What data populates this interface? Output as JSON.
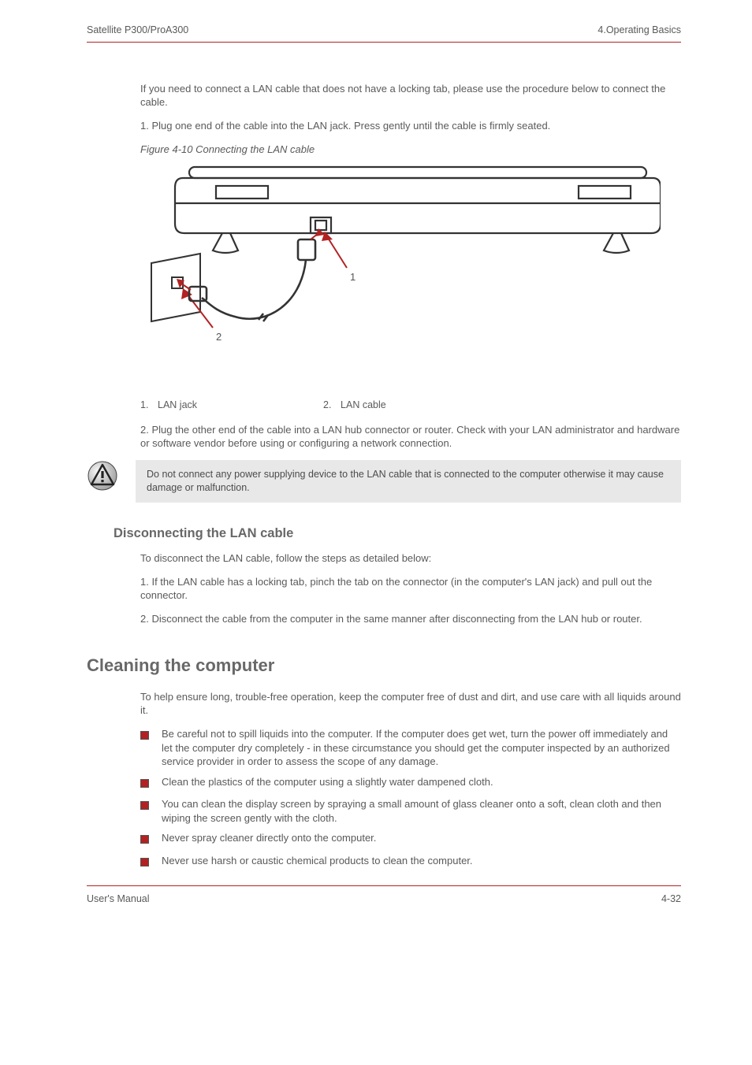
{
  "header": {
    "left": "Satellite P300/ProA300",
    "right": "4.Operating Basics"
  },
  "intro": {
    "p1": "If you need to connect a LAN cable that does not have a locking tab, please use the procedure below to connect the cable.",
    "p2": "1. Plug one end of the cable into the LAN jack. Press gently until the cable is firmly seated.",
    "figTitle": "Figure 4-10 Connecting the LAN cable",
    "callouts": [
      {
        "num": "1.",
        "label": "LAN jack"
      },
      {
        "num": "2.",
        "label": "LAN cable"
      }
    ],
    "p3": "2. Plug the other end of the cable into a LAN hub connector or router. Check with your LAN administrator and hardware or software vendor before using or configuring a network connection."
  },
  "note": "Do not connect any power supplying device to the LAN cable that is connected to the computer otherwise it may cause damage or malfunction.",
  "disc": {
    "title": "Disconnecting the LAN cable",
    "p1": "To disconnect the LAN cable, follow the steps as detailed below:",
    "p2": "1. If the LAN cable has a locking tab, pinch the tab on the connector (in the computer's LAN jack) and pull out the connector.",
    "p3": "2. Disconnect the cable from the computer in the same manner after disconnecting from the LAN hub or router."
  },
  "clean": {
    "title": "Cleaning the computer",
    "p1": "To help ensure long, trouble-free operation, keep the computer free of dust and dirt, and use care with all liquids around it.",
    "bullets": [
      "Be careful not to spill liquids into the computer. If the computer does get wet, turn the power off immediately and let the computer dry completely - in these circumstance you should get the computer inspected by an authorized service provider in order to assess the scope of any damage.",
      "Clean the plastics of the computer using a slightly water dampened cloth.",
      "You can clean the display screen by spraying a small amount of glass cleaner onto a soft, clean cloth and then wiping the screen gently with the cloth.",
      "Never spray cleaner directly onto the computer.",
      "Never use harsh or caustic chemical products to clean the computer."
    ]
  },
  "footer": {
    "left": "User's Manual",
    "right": "4-32"
  }
}
